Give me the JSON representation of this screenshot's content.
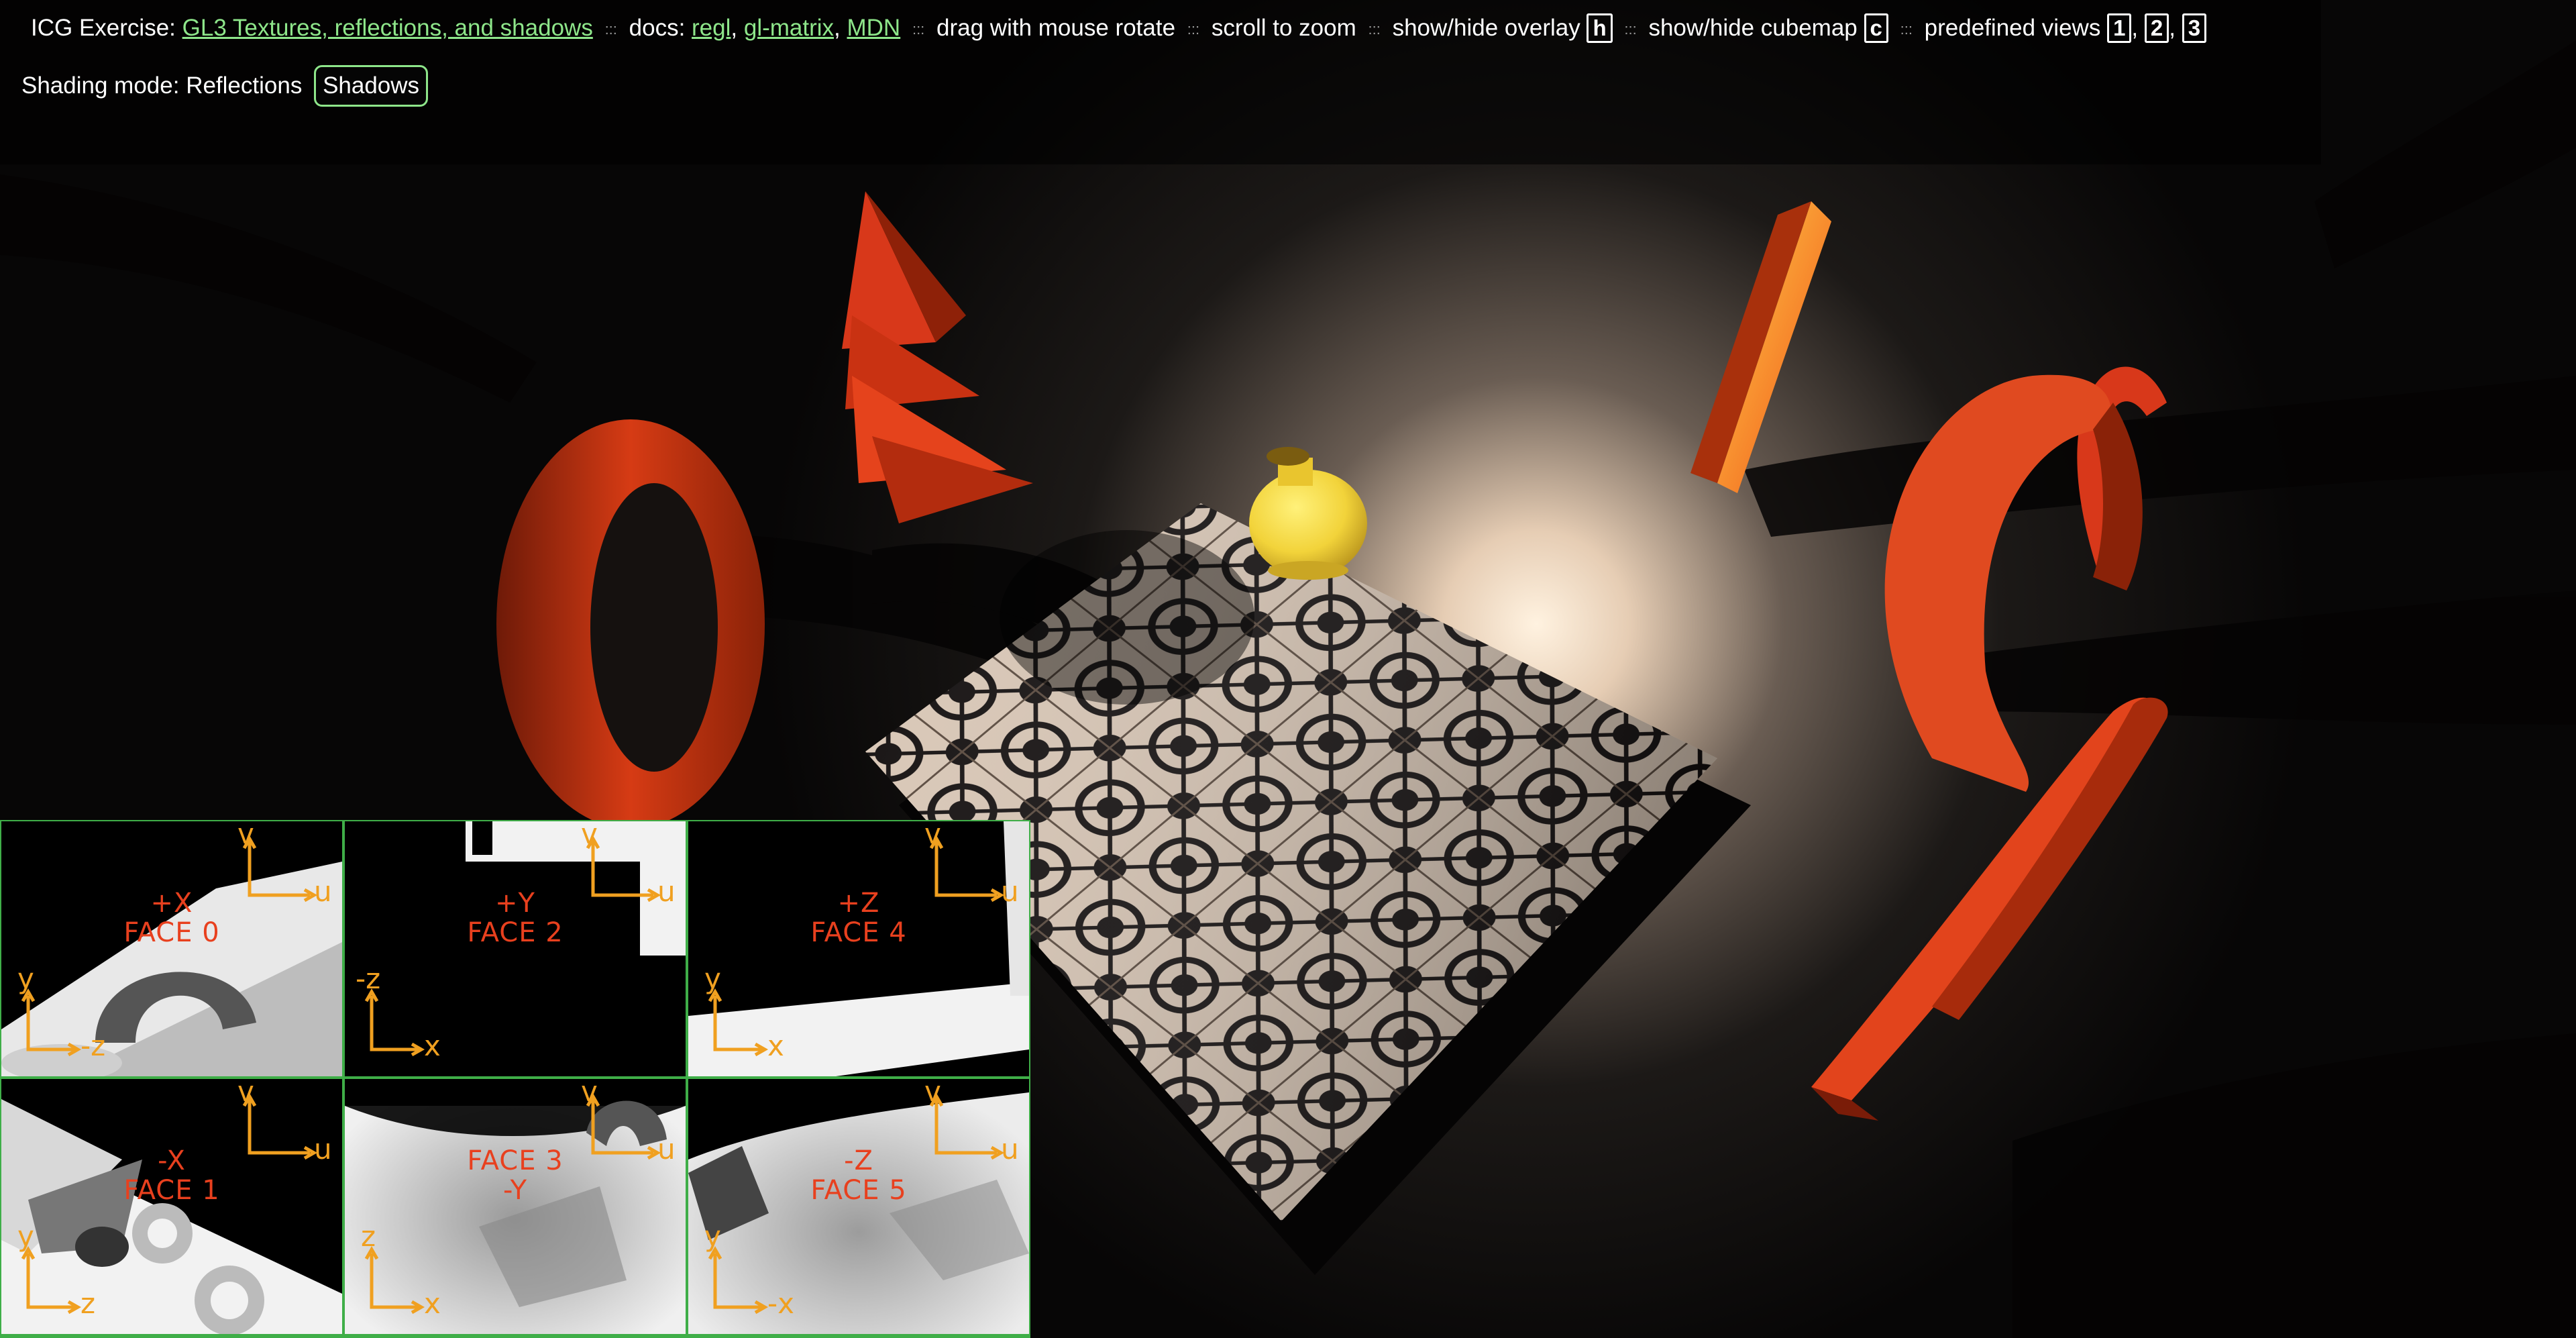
{
  "header": {
    "prefix": "ICG Exercise:",
    "exercise_link": "GL3 Textures, reflections, and shadows",
    "docs_label": "docs:",
    "doc_links": [
      "regl",
      "gl-matrix",
      "MDN"
    ],
    "hints": {
      "rotate": "drag with mouse rotate",
      "zoom": "scroll to zoom",
      "overlay": "show/hide overlay",
      "overlay_key": "h",
      "cubemap": "show/hide cubemap",
      "cubemap_key": "c",
      "views": "predefined views",
      "view_keys": [
        "1",
        "2",
        "3"
      ]
    },
    "separator": ":::"
  },
  "shading": {
    "label": "Shading mode:",
    "current": "Reflections",
    "button": "Shadows"
  },
  "cubemap": {
    "faces": [
      {
        "axis": "+X",
        "name": "FACE 0",
        "u": "u",
        "v": "v",
        "ax1": "y",
        "ax2": "-z"
      },
      {
        "axis": "+Y",
        "name": "FACE 2",
        "u": "u",
        "v": "v",
        "ax1": "-z",
        "ax2": "x"
      },
      {
        "axis": "+Z",
        "name": "FACE 4",
        "u": "u",
        "v": "v",
        "ax1": "y",
        "ax2": "x"
      },
      {
        "axis": "-X",
        "name": "FACE 1",
        "u": "u",
        "v": "v",
        "ax1": "y",
        "ax2": "z"
      },
      {
        "axis": "-Y",
        "name": "FACE 3",
        "u": "u",
        "v": "v",
        "ax1": "z",
        "ax2": "x"
      },
      {
        "axis": "-Z",
        "name": "FACE 5",
        "u": "u",
        "v": "v",
        "ax1": "y",
        "ax2": "-x"
      }
    ]
  },
  "colors": {
    "link": "#8ee68a",
    "panel_border": "#3fae48",
    "face_label": "#e8401e",
    "axis": "#f0a020",
    "object": "#e03a14",
    "vase": "#f2d33a"
  }
}
